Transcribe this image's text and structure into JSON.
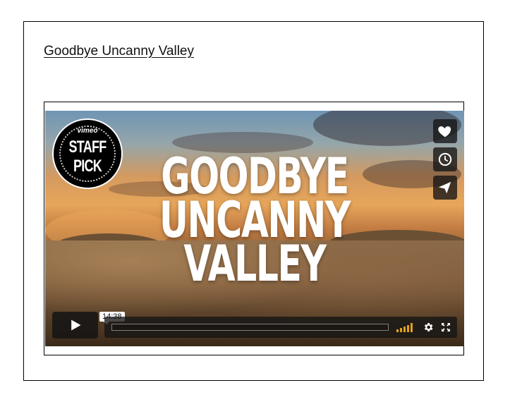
{
  "page": {
    "title": "Goodbye Uncanny Valley"
  },
  "video": {
    "title_art_lines": [
      "GOODBYE",
      "UNCANNY",
      "VALLEY"
    ],
    "badge": {
      "brand": "vimeo",
      "line1": "STAFF",
      "line2": "PICK"
    },
    "duration": "14:38",
    "side_actions": [
      "heart-icon",
      "clock-icon",
      "send-icon"
    ],
    "controls": [
      "play-icon",
      "volume-icon",
      "settings-gear-icon",
      "fullscreen-icon"
    ],
    "accent_color": "#e0a21a",
    "progress_fraction": 0
  }
}
